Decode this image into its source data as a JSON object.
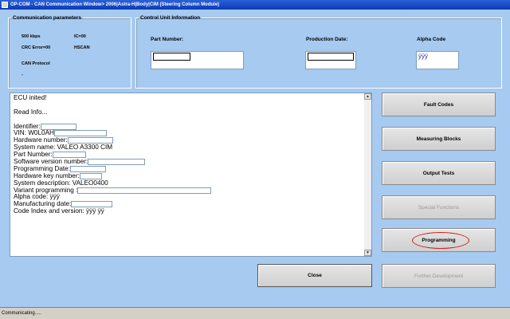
{
  "window": {
    "title": "OP-COM - CAN Communication Window> 2006|Astra-H|Body|CIM (Steering Column Module)"
  },
  "comm_params": {
    "legend": "Communication parameters",
    "baud": "500 kbps",
    "ic": "IC=00",
    "crc": "CRC Error=00",
    "hscan": "HSCAN",
    "protocol": "CAN Protocol",
    "dash": "-"
  },
  "control_unit": {
    "legend": "Control Unit Information",
    "part_number_label": "Part Number:",
    "production_date_label": "Production Date:",
    "alpha_code_label": "Alpha Code",
    "alpha_code_value": "ÿÿÿ"
  },
  "log": {
    "ecu_inited": "ECU inited!",
    "read_info": "Read Info...",
    "identifier": "Identifier:",
    "vin": "VIN: W0L0AH",
    "hardware_number": "Hardware number:",
    "system_name": "System name: VALEO A3300 CIM",
    "part_number": "Part Number:",
    "software_version": "Software version number:",
    "programming_date": "Programming Date:",
    "hardware_key": "Hardware key number:",
    "system_description": "System description: VALEO0400",
    "variant_programming": "Variant programming :",
    "alpha_code": "Alpha code: ÿÿÿ",
    "manufacturing_date": "Manufacturing date:",
    "code_index": "Code Index and version:  ÿÿÿ ÿÿ"
  },
  "buttons": {
    "fault_codes": "Fault Codes",
    "measuring_blocks": "Measuring Blocks",
    "output_tests": "Output Tests",
    "special_functions": "Special Functions",
    "programming": "Programming",
    "close": "Close",
    "further_development": "Further Development"
  },
  "status": {
    "text": "Communicating....."
  },
  "colors": {
    "background": "#a6caf0",
    "highlight_ring": "#d61818",
    "titlebar": "#0a3cb8"
  }
}
